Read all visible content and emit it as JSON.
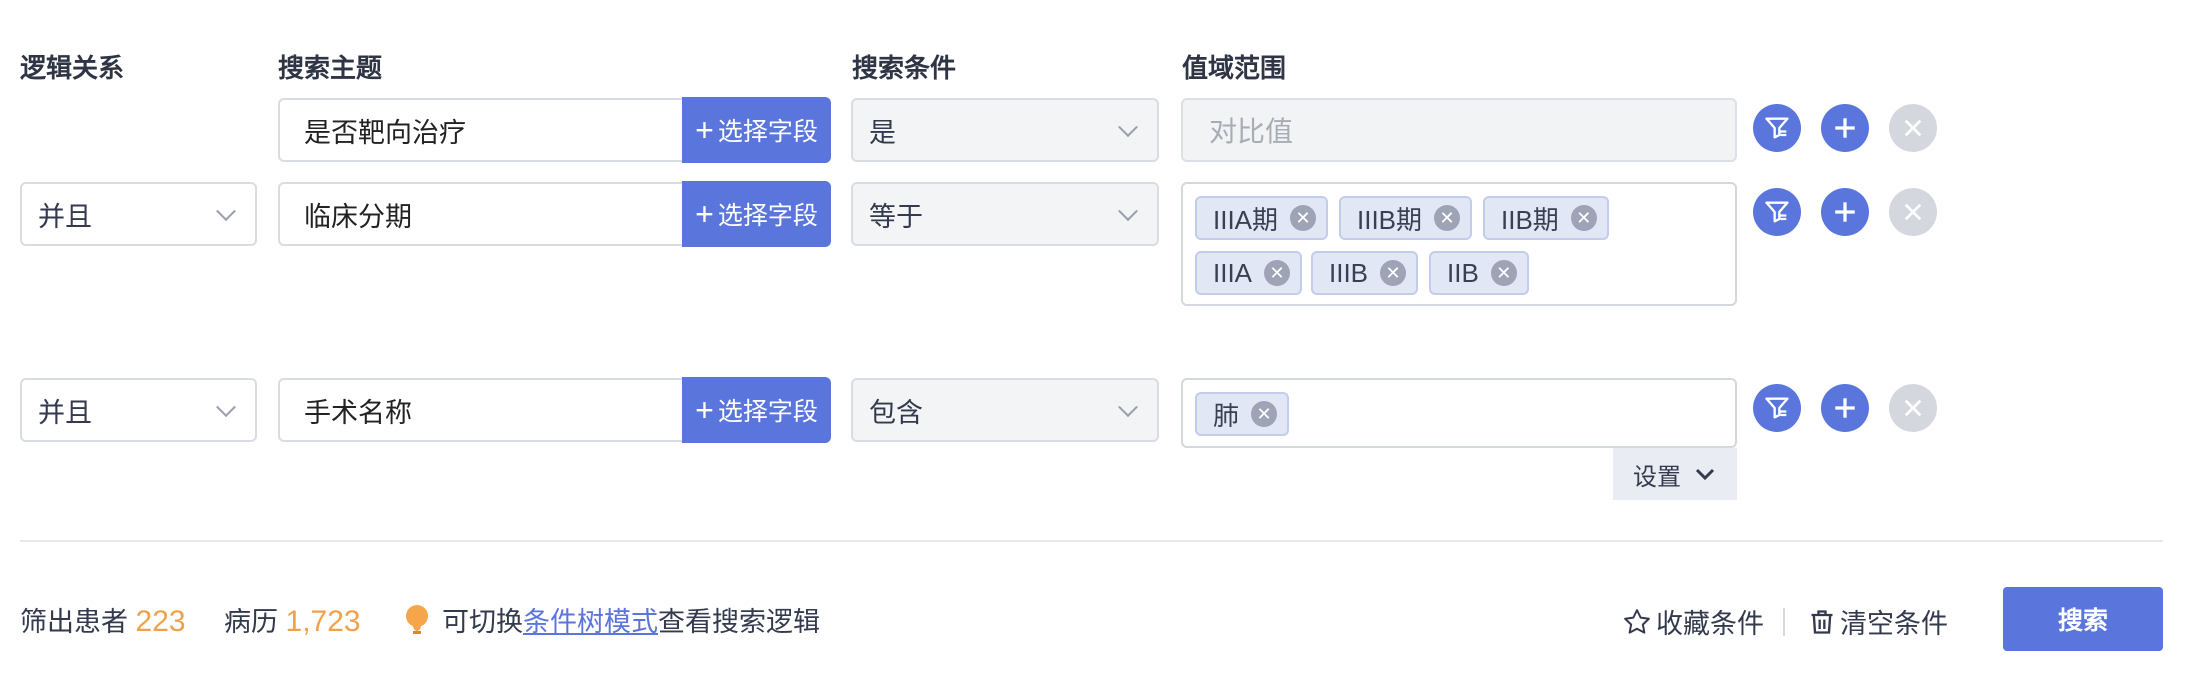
{
  "headers": {
    "logic": "逻辑关系",
    "topic": "搜索主题",
    "condition": "搜索条件",
    "range": "值域范围"
  },
  "pick_label": "选择字段",
  "rows": [
    {
      "logic": "",
      "topic": "是否靶向治疗",
      "condition": "是",
      "value_placeholder": "对比值",
      "tags": []
    },
    {
      "logic": "并且",
      "topic": "临床分期",
      "condition": "等于",
      "tags": [
        "IIIA期",
        "IIIB期",
        "IIB期",
        "IIIA",
        "IIIB",
        "IIB"
      ]
    },
    {
      "logic": "并且",
      "topic": "手术名称",
      "condition": "包含",
      "tags": [
        "肺"
      ]
    }
  ],
  "settings_label": "设置",
  "footer": {
    "patients_label": "筛出患者",
    "patients_count": "223",
    "records_label": "病历",
    "records_count": "1,723",
    "tip_prefix": "可切换",
    "tip_link": "条件树模式",
    "tip_suffix": "查看搜索逻辑",
    "favorite_label": "收藏条件",
    "clear_label": "清空条件",
    "search_label": "搜索"
  },
  "colors": {
    "primary": "#5a76dc",
    "accent_number": "#f0a24a",
    "tag_bg": "#e2e7f6"
  }
}
